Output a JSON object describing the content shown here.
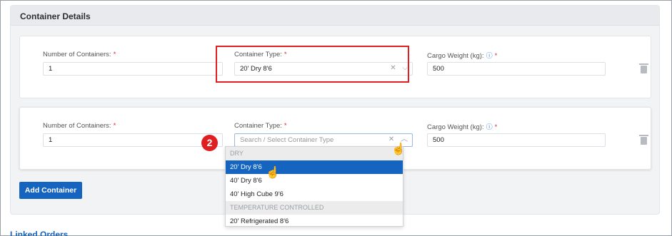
{
  "section": {
    "title": "Container Details"
  },
  "row1": {
    "num_label": "Number of Containers:",
    "num_value": "1",
    "type_label": "Container Type:",
    "type_value": "20' Dry 8'6",
    "weight_label": "Cargo Weight (kg):",
    "weight_value": "500"
  },
  "row2": {
    "num_label": "Number of Containers:",
    "num_value": "1",
    "type_label": "Container Type:",
    "type_placeholder": "Search / Select Container Type",
    "weight_label": "Cargo Weight (kg):",
    "weight_value": "500"
  },
  "required_mark": "*",
  "icons": {
    "info": "ⓘ",
    "clear": "✕",
    "chevron_down": "⌵",
    "chevron_up": "︿",
    "pointer": "☝"
  },
  "badge_number": "2",
  "add_button": "Add Container",
  "dropdown": {
    "groups": [
      {
        "label": "DRY",
        "options": [
          "20' Dry 8'6",
          "40' Dry 8'6",
          "40' High Cube 9'6"
        ]
      },
      {
        "label": "TEMPERATURE CONTROLLED",
        "options": [
          "20' Refrigerated 8'6"
        ]
      }
    ]
  },
  "peek_text": "Linked Orders",
  "colors": {
    "accent": "#1565c0",
    "highlight": "#e02020",
    "required": "#d32f2f"
  }
}
